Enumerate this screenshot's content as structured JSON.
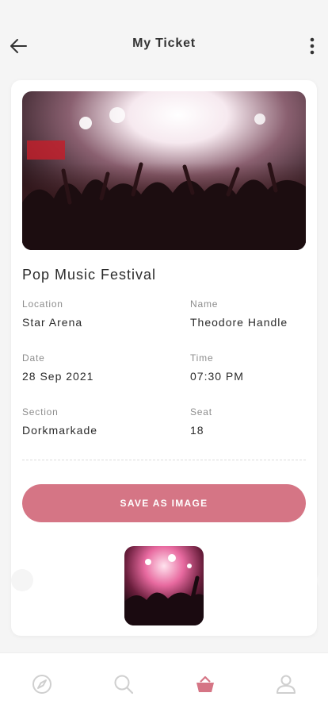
{
  "header": {
    "title": "My Ticket",
    "back_icon": "arrow-left-icon",
    "more_icon": "more-vertical-icon"
  },
  "ticket": {
    "event_name": "Pop Music Festival",
    "fields": {
      "location": {
        "label": "Location",
        "value": "Star Arena"
      },
      "name": {
        "label": "Name",
        "value": "Theodore Handle"
      },
      "date": {
        "label": "Date",
        "value": "28 Sep 2021"
      },
      "time": {
        "label": "Time",
        "value": "07:30 PM"
      },
      "section": {
        "label": "Section",
        "value": "Dorkmarkade"
      },
      "seat": {
        "label": "Seat",
        "value": "18"
      }
    },
    "save_button_label": "SAVE AS IMAGE"
  },
  "tabbar": {
    "items": [
      {
        "icon": "compass-icon",
        "active": false
      },
      {
        "icon": "search-icon",
        "active": false
      },
      {
        "icon": "ticket-bag-icon",
        "active": true
      },
      {
        "icon": "user-icon",
        "active": false
      }
    ]
  },
  "colors": {
    "accent": "#d57585",
    "background": "#f5f5f5",
    "card": "#ffffff",
    "label": "#8d8d8d",
    "inactive_icon": "#cfcfcf"
  }
}
